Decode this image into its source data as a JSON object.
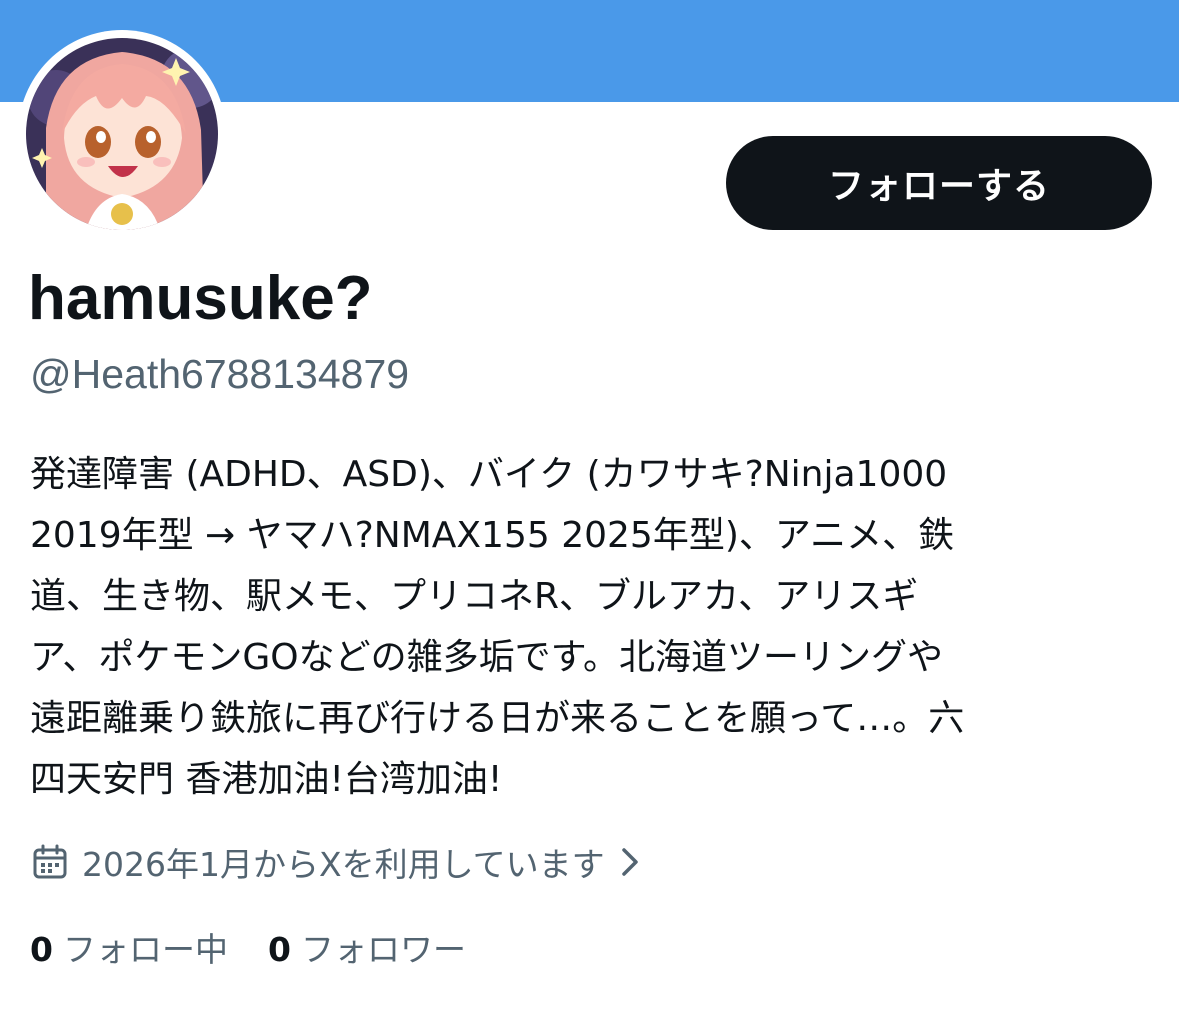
{
  "colors": {
    "banner": "#4a99e9",
    "follow_button_bg": "#0f1419",
    "text_primary": "#0f1419",
    "text_secondary": "#536471"
  },
  "profile": {
    "display_name": "hamusuke?",
    "handle": "@Heath6788134879",
    "follow_button_label": "フォローする",
    "bio_lines": [
      "発達障害 (ADHD、ASD)、バイク (カワサキ?Ninja1000",
      "2019年型 → ヤマハ?NMAX155 2025年型)、アニメ、鉄",
      "道、生き物、駅メモ、プリコネR、ブルアカ、アリスギ",
      "ア、ポケモンGOなどの雑多垢です。北海道ツーリングや",
      "遠距離乗り鉄旅に再び行ける日が来ることを願って…。六",
      "四天安門 香港加油!台湾加油!"
    ],
    "joined_text": "2026年1月からXを利用しています",
    "joined_icon": "calendar-icon",
    "following_count": "0",
    "following_label": "フォロー中",
    "followers_count": "0",
    "followers_label": "フォロワー"
  }
}
